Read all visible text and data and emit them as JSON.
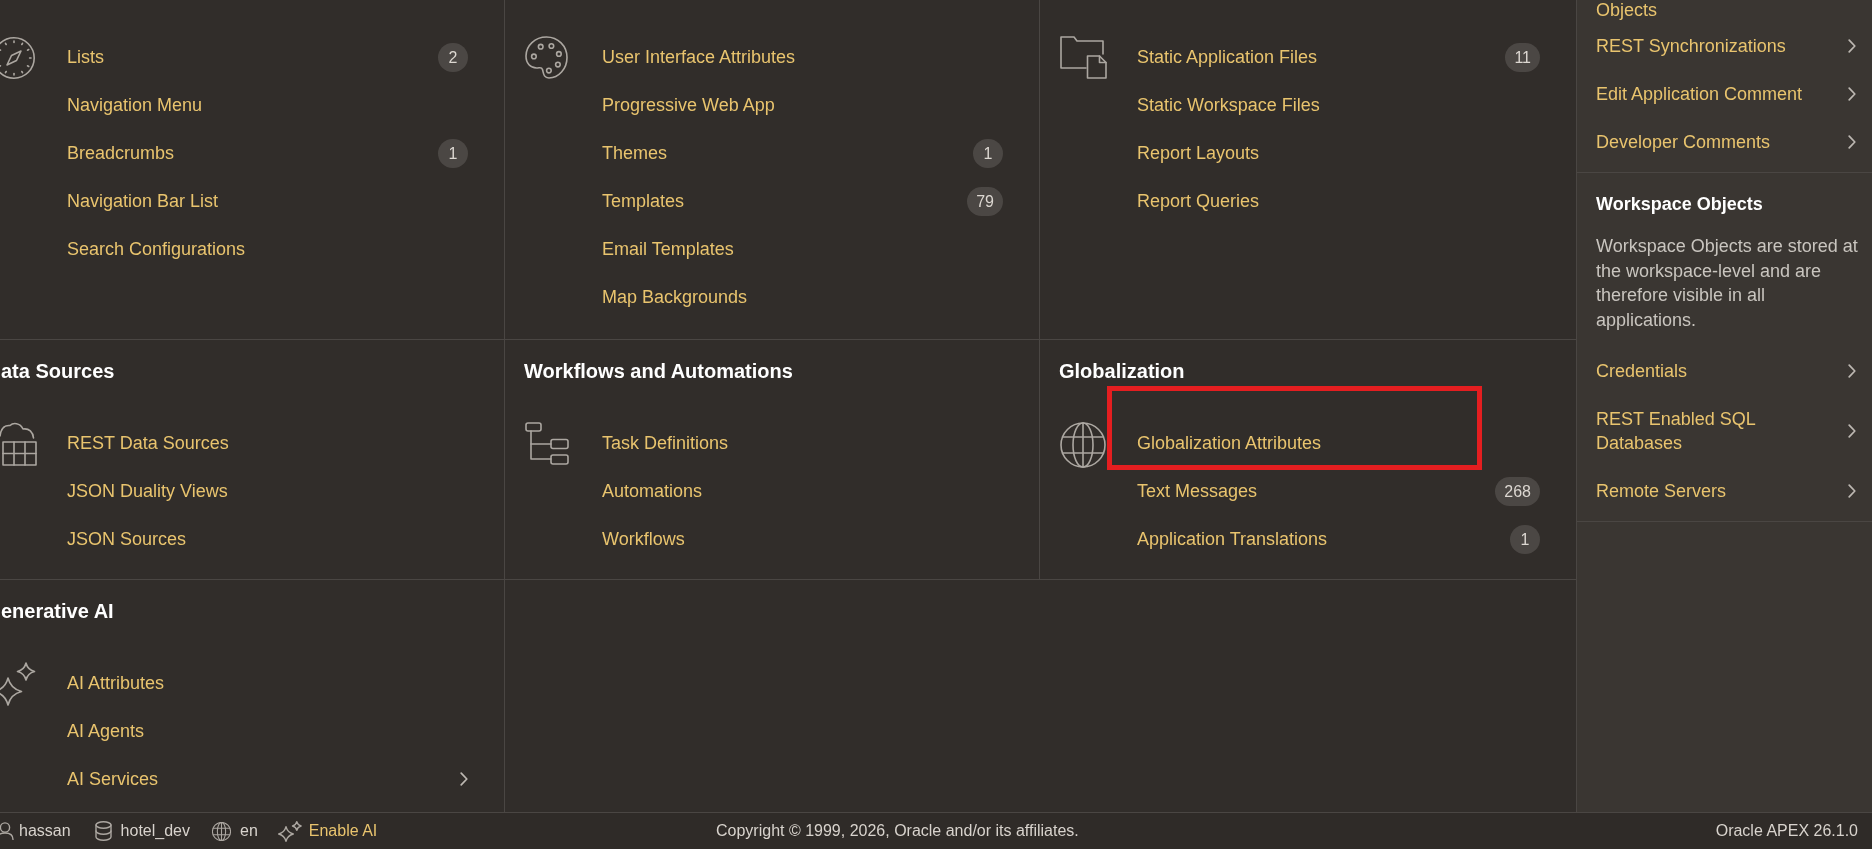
{
  "content_grid": {
    "rows": [
      {
        "sections": [
          {
            "items": [
              {
                "label": "Lists",
                "count": "2"
              },
              {
                "label": "Navigation Menu"
              },
              {
                "label": "Breadcrumbs",
                "count": "1"
              },
              {
                "label": "Navigation Bar List"
              },
              {
                "label": "Search Configurations"
              }
            ]
          },
          {
            "items": [
              {
                "label": "User Interface Attributes"
              },
              {
                "label": "Progressive Web App"
              },
              {
                "label": "Themes",
                "count": "1"
              },
              {
                "label": "Templates",
                "count": "79"
              },
              {
                "label": "Email Templates"
              },
              {
                "label": "Map Backgrounds"
              }
            ]
          },
          {
            "items": [
              {
                "label": "Static Application Files",
                "count": "11"
              },
              {
                "label": "Static Workspace Files"
              },
              {
                "label": "Report Layouts"
              },
              {
                "label": "Report Queries"
              }
            ]
          }
        ]
      },
      {
        "sections": [
          {
            "title": "ata Sources",
            "items": [
              {
                "label": "REST Data Sources"
              },
              {
                "label": "JSON Duality Views"
              },
              {
                "label": "JSON Sources"
              }
            ]
          },
          {
            "title": "Workflows and Automations",
            "items": [
              {
                "label": "Task Definitions"
              },
              {
                "label": "Automations"
              },
              {
                "label": "Workflows"
              }
            ]
          },
          {
            "title": "Globalization",
            "items": [
              {
                "label": "Globalization Attributes",
                "highlighted": true
              },
              {
                "label": "Text Messages",
                "count": "268",
                "highlighted": false
              },
              {
                "label": "Application Translations",
                "count": "1",
                "highlighted": false
              }
            ]
          }
        ]
      },
      {
        "sections": [
          {
            "title": "enerative AI",
            "items": [
              {
                "label": "AI Attributes",
                "kind": "link"
              },
              {
                "label": "AI Agents",
                "kind": "link"
              },
              {
                "label": "AI Services",
                "kind": "submenu"
              }
            ]
          }
        ]
      }
    ]
  },
  "sidebar": {
    "groups": [
      {
        "items": [
          {
            "label": "Objects",
            "kind": "link"
          },
          {
            "label": "REST Synchronizations",
            "kind": "submenu"
          },
          {
            "label": "Edit Application Comment",
            "kind": "submenu"
          },
          {
            "label": "Developer Comments",
            "kind": "submenu"
          }
        ]
      },
      {
        "title": "Workspace Objects",
        "description": "Workspace Objects are stored at the workspace-level and are therefore visible in all applications.",
        "items": [
          {
            "label": "Credentials",
            "kind": "submenu"
          },
          {
            "label": "REST Enabled SQL Databases",
            "kind": "submenu"
          },
          {
            "label": "Remote Servers",
            "kind": "submenu"
          }
        ]
      }
    ]
  },
  "footer": {
    "user": "hassan",
    "workspace": "hotel_dev",
    "language": "en",
    "ai_link": "Enable AI",
    "copyright": "Copyright © 1999, 2026, Oracle and/or its affiliates.",
    "version": "Oracle APEX 26.1.0"
  }
}
